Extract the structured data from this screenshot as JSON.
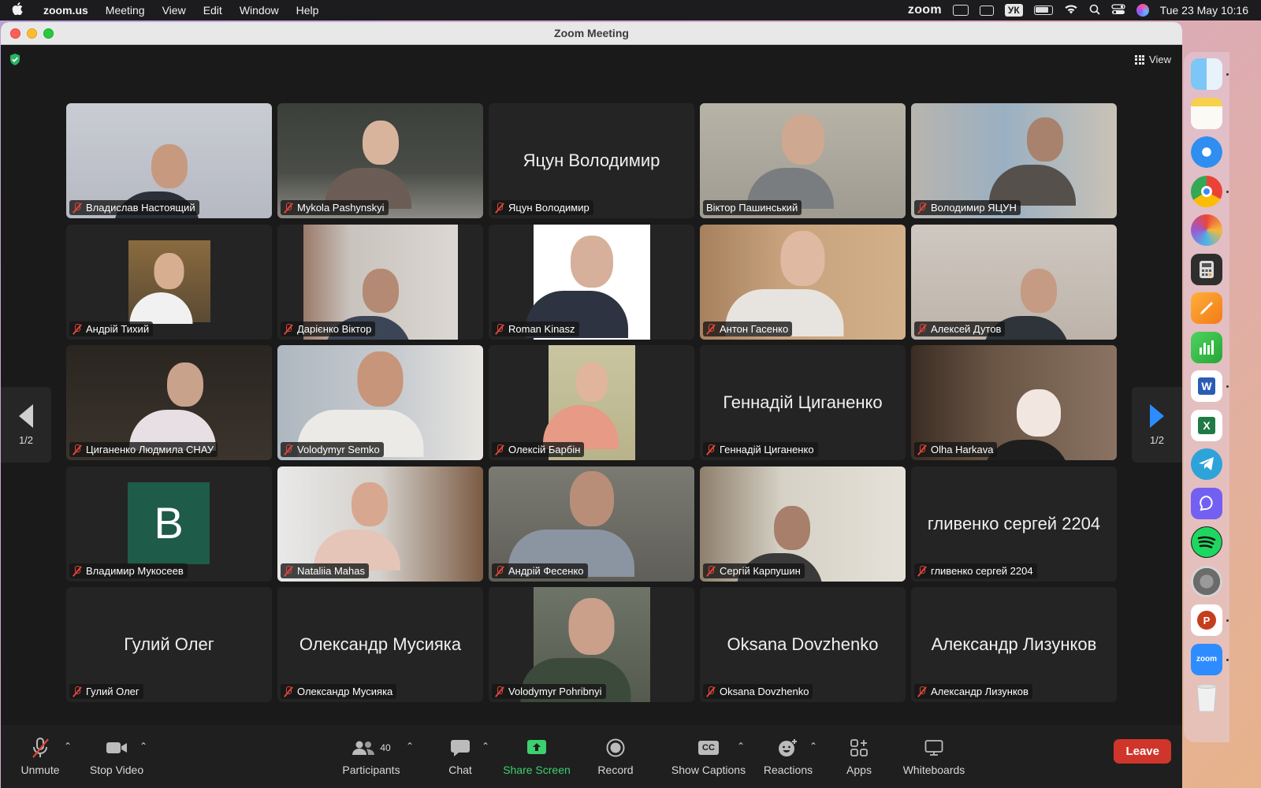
{
  "menubar": {
    "app_name": "zoom.us",
    "items": [
      "Meeting",
      "View",
      "Edit",
      "Window",
      "Help"
    ],
    "zoom_logo": "zoom",
    "keyboard_layout": "УК",
    "datetime": "Tue 23 May  10:16"
  },
  "window": {
    "title": "Zoom Meeting",
    "view_label": "View",
    "page_left": "1/2",
    "page_right": "1/2"
  },
  "participants": [
    {
      "name": "Владислав Настоящий",
      "video": true
    },
    {
      "name": "Mykola Pashynskyi",
      "video": true
    },
    {
      "name": "Яцун Володимир",
      "video": false,
      "display_name": "Яцун Володимир"
    },
    {
      "name": "Віктор Пашинський",
      "video": true,
      "active_speaker": true
    },
    {
      "name": "Володимир ЯЦУН",
      "video": true
    },
    {
      "name": "Андрій Тихий",
      "video": true
    },
    {
      "name": "Дарієнко Віктор",
      "video": true
    },
    {
      "name": "Roman Kinasz",
      "video": true
    },
    {
      "name": "Антон Гасенко",
      "video": true
    },
    {
      "name": "Алексей Дутов",
      "video": true
    },
    {
      "name": "Циганенко Людмила СНАУ",
      "video": true
    },
    {
      "name": "Volodymyr Semko",
      "video": true
    },
    {
      "name": "Олексій Барбін",
      "video": true
    },
    {
      "name": "Геннадій Циганенко",
      "video": false,
      "display_name": "Геннадій Циганенко"
    },
    {
      "name": "Olha Harkava",
      "video": true
    },
    {
      "name": "Владимир Мукосеев",
      "video": false,
      "avatar_letter": "B"
    },
    {
      "name": "Nataliia Mahas",
      "video": true
    },
    {
      "name": "Андрій Фесенко",
      "video": true
    },
    {
      "name": "Сергій Карпушин",
      "video": true
    },
    {
      "name": "гливенко сергей 2204",
      "video": false,
      "display_name": "гливенко сергей 2204"
    },
    {
      "name": "Гулий Олег",
      "video": false,
      "display_name": "Гулий Олег"
    },
    {
      "name": "Олександр Мусияка",
      "video": false,
      "display_name": "Олександр Мусияка"
    },
    {
      "name": "Volodymyr Pohribnyi",
      "video": true
    },
    {
      "name": "Oksana Dovzhenko",
      "video": false,
      "display_name": "Oksana Dovzhenko"
    },
    {
      "name": "Александр Лизунков",
      "video": false,
      "display_name": "Александр Лизунков"
    }
  ],
  "toolbar": {
    "unmute": "Unmute",
    "stop_video": "Stop Video",
    "participants": "Participants",
    "participants_count": "40",
    "chat": "Chat",
    "share_screen": "Share Screen",
    "record": "Record",
    "show_captions": "Show Captions",
    "captions_icon_text": "CC",
    "reactions": "Reactions",
    "apps": "Apps",
    "whiteboards": "Whiteboards",
    "leave": "Leave"
  },
  "dock": {
    "apps": [
      "finder",
      "notes",
      "safari",
      "chrome",
      "palette",
      "calculator",
      "pages",
      "numbers",
      "word",
      "excel",
      "telegram",
      "viber",
      "spotify",
      "system-settings",
      "powerpoint",
      "zoom",
      "trash"
    ],
    "zoom_label": "zoom"
  },
  "colors": {
    "active_speaker_border": "#6fd15a",
    "leave_button": "#d0352b",
    "share_screen": "#3cd06f",
    "muted_icon": "#e0453a"
  }
}
